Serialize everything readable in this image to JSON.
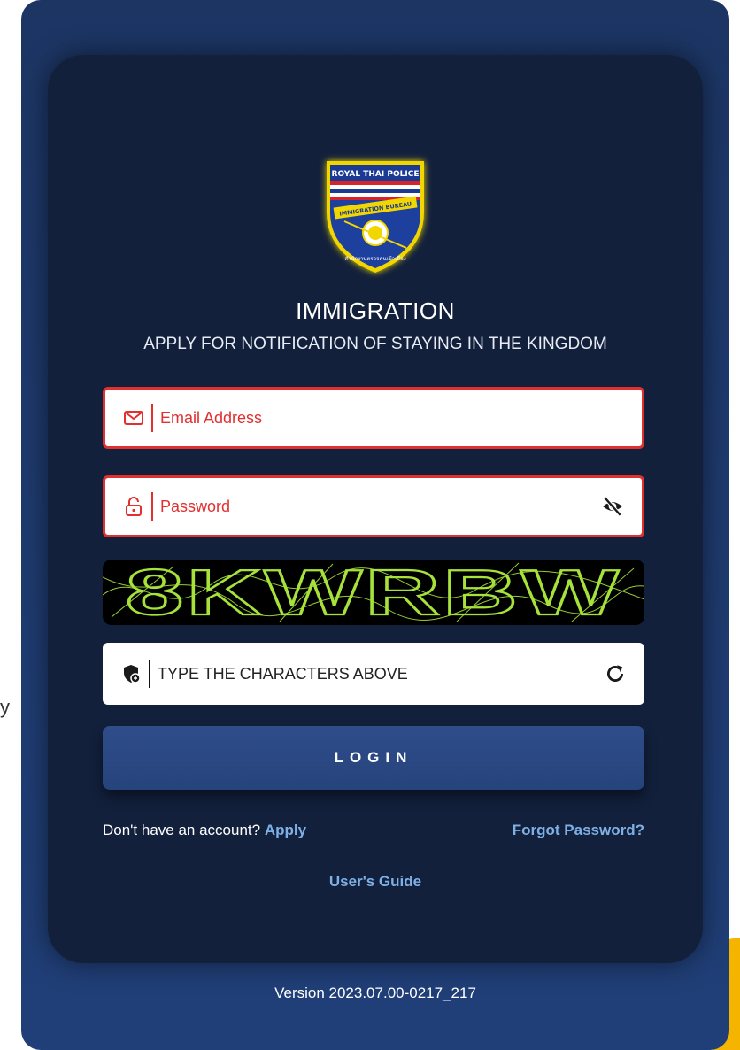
{
  "logo": {
    "top_text": "ROYAL THAI POLICE",
    "band_text": "IMMIGRATION BUREAU",
    "bottom_text": "สำนักงานตรวจคนเข้าเมือง"
  },
  "header": {
    "title": "IMMIGRATION",
    "subtitle": "APPLY FOR NOTIFICATION OF STAYING IN THE KINGDOM"
  },
  "form": {
    "email": {
      "placeholder": "Email Address",
      "value": "",
      "icon": "mail-icon"
    },
    "password": {
      "placeholder": "Password",
      "value": "",
      "icon": "lock-icon",
      "toggle_icon": "eye-slash-icon"
    },
    "captcha": {
      "image_text": "8KWRBW",
      "placeholder": "TYPE THE CHARACTERS ABOVE",
      "icon": "shield-icon",
      "refresh_icon": "refresh-icon"
    },
    "login_label": "LOGIN"
  },
  "links": {
    "no_account": "Don't have an account?",
    "apply": "Apply",
    "forgot": "Forgot Password?",
    "guide": "User's Guide"
  },
  "footer": {
    "version": "Version 2023.07.00-0217_217"
  },
  "stray_char": "y",
  "colors": {
    "outer_panel": "#1c3563",
    "card": "#12203c",
    "error": "#e03030",
    "link": "#7eb0e6",
    "captcha_text": "#a6e23a",
    "button": "#2f4d8a",
    "accent_tab": "#f5b400"
  }
}
